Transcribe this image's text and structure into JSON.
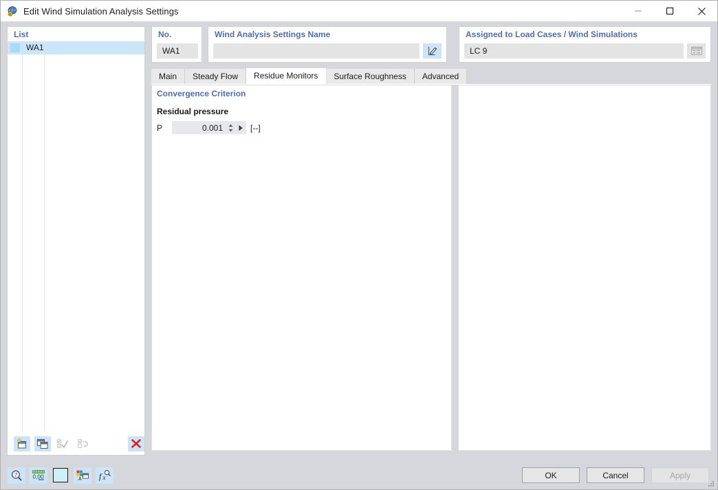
{
  "window": {
    "title": "Edit Wind Simulation Analysis Settings",
    "icon": "wind-simulation-icon",
    "controls": {
      "minimize": "minimize-icon",
      "maximize": "maximize-icon",
      "close": "close-icon"
    }
  },
  "list_panel": {
    "title": "List",
    "rows": [
      {
        "label": "WA1",
        "color": "#a6dcf4",
        "selected": true
      }
    ],
    "toolbar": [
      {
        "name": "new-item-button",
        "icon": "new-window-star-icon",
        "enabled": true
      },
      {
        "name": "copy-item-button",
        "icon": "duplicate-window-icon",
        "enabled": true
      },
      {
        "name": "select-all-button",
        "icon": "check-all-icon",
        "enabled": false
      },
      {
        "name": "invert-selection-button",
        "icon": "invert-selection-icon",
        "enabled": false
      },
      {
        "name": "delete-item-button",
        "icon": "red-x-icon",
        "enabled": true
      }
    ]
  },
  "no_group": {
    "title": "No.",
    "value": "WA1"
  },
  "name_group": {
    "title": "Wind Analysis Settings Name",
    "value": "",
    "placeholder": "",
    "edit_button_icon": "pencil-edit-icon"
  },
  "assigned_group": {
    "title": "Assigned to Load Cases / Wind Simulations",
    "value": "LC 9",
    "list_button_icon": "table-list-icon"
  },
  "tabs": [
    {
      "label": "Main",
      "active": false
    },
    {
      "label": "Steady Flow",
      "active": false
    },
    {
      "label": "Residue Monitors",
      "active": true
    },
    {
      "label": "Surface Roughness",
      "active": false
    },
    {
      "label": "Advanced",
      "active": false
    }
  ],
  "convergence": {
    "section_title": "Convergence Criterion",
    "sub_label": "Residual pressure",
    "symbol": "P",
    "value": "0.001",
    "unit": "[--]",
    "spinner_icon": "spinner-up-down-icon",
    "play_icon": "play-arrow-icon"
  },
  "footer": {
    "icons": [
      {
        "name": "help-magnifier-button",
        "icon": "magnifier-question-icon"
      },
      {
        "name": "decimal-places-button",
        "icon": "decimal-0-00-icon",
        "label": "0,00"
      },
      {
        "name": "color-swatch-button",
        "icon": "color-swatch-icon",
        "color": "#cdf0f7"
      },
      {
        "name": "display-properties-button",
        "icon": "color-palette-window-icon"
      },
      {
        "name": "formula-button",
        "icon": "fx-function-icon"
      }
    ],
    "buttons": [
      {
        "label": "OK",
        "name": "ok-button",
        "enabled": true
      },
      {
        "label": "Cancel",
        "name": "cancel-button",
        "enabled": true
      },
      {
        "label": "Apply",
        "name": "apply-button",
        "enabled": false
      }
    ]
  },
  "colors": {
    "accent_blue": "#4e6fa8",
    "selection_blue": "#cce6f9",
    "chrome": "#d6d6dd",
    "danger_red": "#e02020"
  }
}
